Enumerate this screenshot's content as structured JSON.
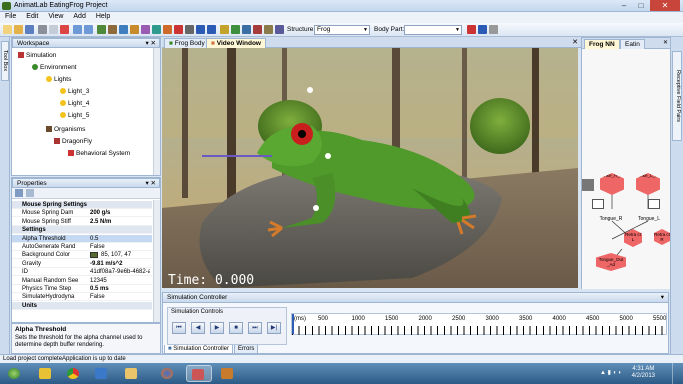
{
  "window": {
    "title": "AnimatLab EatingFrog Project",
    "min": "–",
    "max": "□",
    "close": "✕"
  },
  "menu": [
    "File",
    "Edit",
    "View",
    "Add",
    "Help"
  ],
  "toolbar": {
    "structure_label": "Structure:",
    "structure_value": "Frog",
    "bodypart_label": "Body Part:",
    "bodypart_value": ""
  },
  "left_tabs": {
    "toolbox": "Tool Box"
  },
  "workspace": {
    "title": "Workspace",
    "tree": [
      {
        "label": "Simulation",
        "icon": "simulation-icon"
      },
      {
        "label": "Environment",
        "icon": "environment-icon"
      },
      {
        "label": "Lights",
        "icon": "folder-icon"
      },
      {
        "label": "Light_3",
        "icon": "bulb-icon"
      },
      {
        "label": "Light_4",
        "icon": "bulb-icon"
      },
      {
        "label": "Light_5",
        "icon": "bulb-icon"
      },
      {
        "label": "Organisms",
        "icon": "folder-icon"
      },
      {
        "label": "DragonFly",
        "icon": "organism-icon"
      },
      {
        "label": "Behavioral System",
        "icon": "behavioral-system-icon"
      }
    ]
  },
  "properties": {
    "title": "Properties",
    "rows": [
      {
        "k": "Mouse Spring Settings",
        "v": "",
        "cat": true
      },
      {
        "k": "Mouse Spring Dam",
        "v": "200 g/s",
        "bold": true
      },
      {
        "k": "Mouse Spring Stiff",
        "v": "2.5 N/m",
        "bold": true
      },
      {
        "k": "Settings",
        "v": "",
        "cat": true
      },
      {
        "k": "Alpha Threshold",
        "v": "0.5"
      },
      {
        "k": "AutoGenerate Rand",
        "v": "False"
      },
      {
        "k": "Background Color",
        "v": "85, 107, 47"
      },
      {
        "k": "Gravity",
        "v": "-9.81 m/s^2",
        "bold": true
      },
      {
        "k": "ID",
        "v": "41df08a7-9e6b-4682-a0f2-c"
      },
      {
        "k": "Manual Random See",
        "v": "12345"
      },
      {
        "k": "Physics Time Step",
        "v": "0.5 ms",
        "bold": true
      },
      {
        "k": "SimulateHydrodyna",
        "v": "False"
      },
      {
        "k": "Units",
        "v": "",
        "cat": true
      }
    ],
    "desc_title": "Alpha Threshold",
    "desc_text": "Sets the threshold for the alpha channel used to determine depth buffer rendering."
  },
  "doc_tabs": [
    "Frog Body",
    "Video Window"
  ],
  "scene": {
    "time_text": "Time: 0.000"
  },
  "sim_controller": {
    "title": "Simulation Controller",
    "controls_label": "Simulation Controls",
    "buttons": [
      "⏮",
      "◀",
      "▶",
      "■",
      "⏭",
      "▶|"
    ],
    "ruler_unit": "(ms)",
    "ticks": [
      "500",
      "1000",
      "1500",
      "2000",
      "2500",
      "3000",
      "3500",
      "4000",
      "4500",
      "5000",
      "5500"
    ]
  },
  "bottom_tabs": [
    "Simulation Controller",
    "Errors"
  ],
  "right_panel": {
    "tabs": [
      "Frog NN",
      "Eatin"
    ],
    "nodes": [
      "Strike_R_Ad",
      "Strike_L_Ad",
      "Tongue_R",
      "Tongue_L",
      "Retra ct L",
      "Retra ct R",
      "Tongue_Out _Ad"
    ]
  },
  "right_strip": {
    "label": "Receptive Field Pairs"
  },
  "status": {
    "left": "Load project complete",
    "right": "Application is up to date"
  },
  "taskbar": {
    "time": "4:31 AM",
    "date": "4/2/2013"
  },
  "colors": {
    "background_color_swatch": "#556b2f",
    "accent": "#3b6d1e"
  }
}
